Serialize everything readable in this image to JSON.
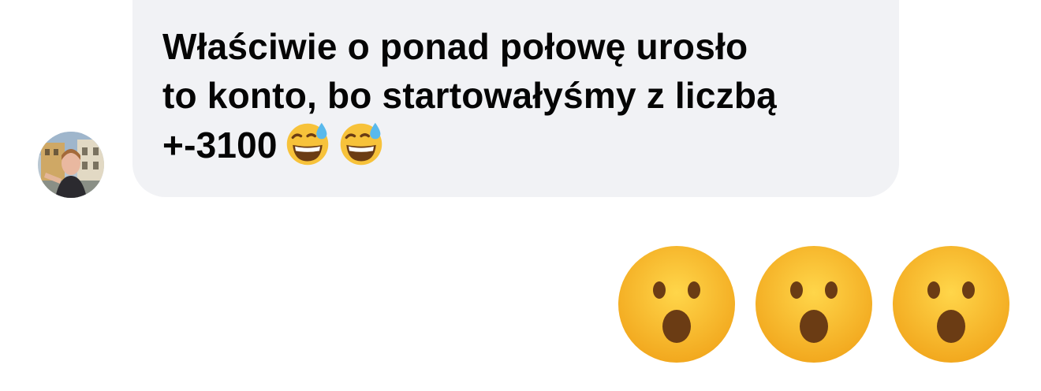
{
  "conversation": {
    "incoming_message": {
      "lines": [
        "Właściwie o ponad połowę urosło",
        "to konto, bo startowałyśmy z liczbą",
        "+-3100"
      ],
      "trailing_emojis": [
        "grinning-sweat-emoji",
        "grinning-sweat-emoji"
      ],
      "sender_avatar": "avatar"
    },
    "outgoing_message": {
      "emojis": [
        "open-mouth-emoji",
        "open-mouth-emoji",
        "open-mouth-emoji"
      ]
    }
  },
  "colors": {
    "incoming_bubble": "#f1f2f5",
    "text": "#050505",
    "emoji_face": "#f7c23a",
    "emoji_feature": "#6b3c14"
  }
}
